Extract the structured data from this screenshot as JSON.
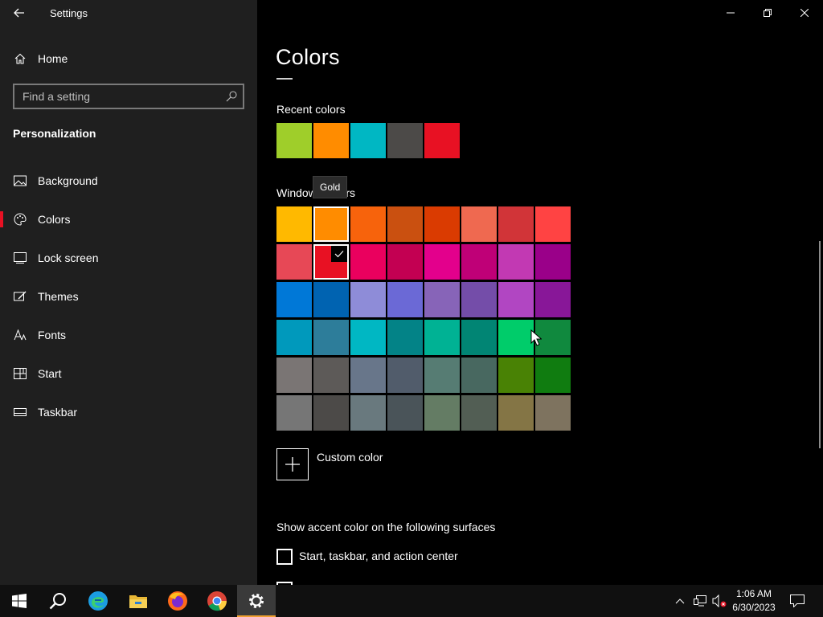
{
  "window": {
    "app_title": "Settings",
    "minimize_icon": "minimize-icon",
    "restore_icon": "restore-icon",
    "close_icon": "close-icon"
  },
  "sidebar": {
    "home_label": "Home",
    "search_placeholder": "Find a setting",
    "section_heading": "Personalization",
    "selected_accent": "#e81123",
    "items": [
      {
        "label": "Background",
        "icon": "picture-icon"
      },
      {
        "label": "Colors",
        "icon": "palette-icon",
        "selected": true
      },
      {
        "label": "Lock screen",
        "icon": "lock-screen-icon"
      },
      {
        "label": "Themes",
        "icon": "themes-icon"
      },
      {
        "label": "Fonts",
        "icon": "fonts-icon"
      },
      {
        "label": "Start",
        "icon": "start-icon"
      },
      {
        "label": "Taskbar",
        "icon": "taskbar-icon"
      }
    ]
  },
  "main": {
    "page_title": "Colors",
    "recent_colors_label": "Recent colors",
    "recent_colors": [
      "#9fce2a",
      "#ff8c00",
      "#00b7c3",
      "#4c4a48",
      "#e81123"
    ],
    "windows_colors_label": "Windows colors",
    "tooltip": "Gold",
    "windows_colors": [
      [
        "#ffb900",
        "#ff8c00",
        "#f7630c",
        "#ca5010",
        "#da3b01",
        "#ef6950",
        "#d13438",
        "#ff4343"
      ],
      [
        "#e74856",
        "#e81123",
        "#ea005e",
        "#c30052",
        "#e3008c",
        "#bf0077",
        "#c239b3",
        "#9a0089"
      ],
      [
        "#0078d7",
        "#0063b1",
        "#8e8cd8",
        "#6b69d6",
        "#8764b8",
        "#744da9",
        "#b146c2",
        "#881798"
      ],
      [
        "#0099bc",
        "#2d7d9a",
        "#00b7c3",
        "#038387",
        "#00b294",
        "#018574",
        "#00cc6a",
        "#10893e"
      ],
      [
        "#7a7574",
        "#5d5a58",
        "#68768a",
        "#515c6b",
        "#567c73",
        "#486860",
        "#498205",
        "#107c10"
      ],
      [
        "#767676",
        "#4c4a48",
        "#69797e",
        "#4a5459",
        "#647c64",
        "#525e54",
        "#847545",
        "#7e735f"
      ]
    ],
    "hovered_color": "#ff8c00",
    "selected_color": "#e81123",
    "custom_color_label": "Custom color",
    "surfaces_label": "Show accent color on the following surfaces",
    "checkbox_start_label": "Start, taskbar, and action center",
    "checkbox_start_checked": false
  },
  "taskbar": {
    "apps": [
      "windows-start-icon",
      "search-icon",
      "edge-icon",
      "file-explorer-icon",
      "firefox-icon",
      "chrome-icon",
      "settings-gear-icon"
    ],
    "active_app": "settings-gear-icon",
    "time": "1:06 AM",
    "date": "6/30/2023"
  }
}
